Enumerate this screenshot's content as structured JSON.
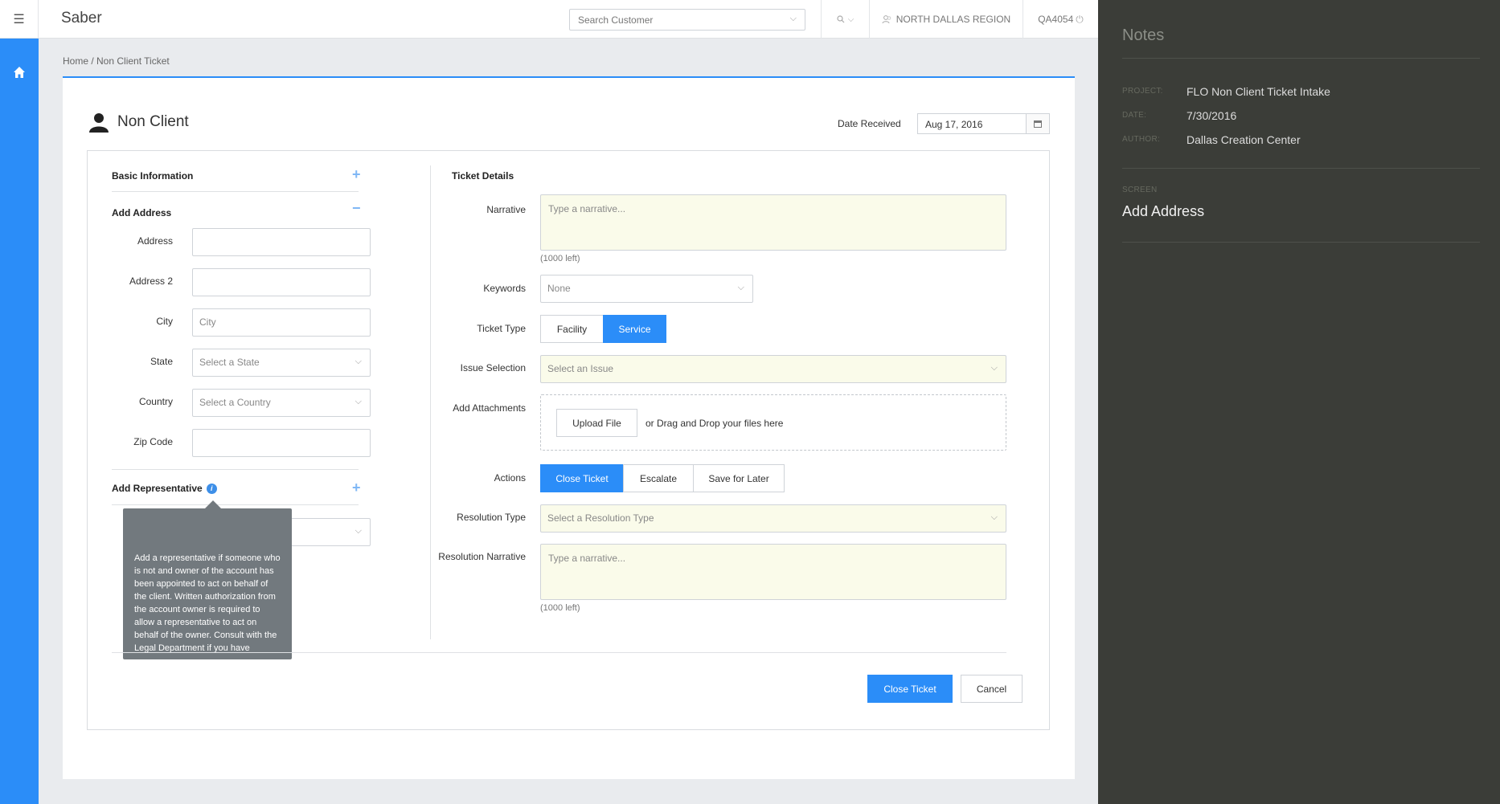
{
  "header": {
    "brand": "Saber",
    "search_placeholder": "Search Customer",
    "region": "NORTH DALLAS REGION",
    "user": "QA4054"
  },
  "breadcrumb": "Home / Non Client Ticket",
  "page": {
    "title": "Non Client",
    "date_label": "Date Received",
    "date_value": "Aug 17, 2016"
  },
  "basic_info": {
    "title": "Basic Information",
    "add_address_title": "Add Address",
    "fields": [
      {
        "label": "Address",
        "value": "",
        "placeholder": ""
      },
      {
        "label": "Address 2",
        "value": "",
        "placeholder": ""
      },
      {
        "label": "City",
        "value": "",
        "placeholder": "City"
      },
      {
        "label": "State",
        "value": "Select a State"
      },
      {
        "label": "Country",
        "value": "Select a Country"
      },
      {
        "label": "Zip Code",
        "value": "",
        "placeholder": ""
      }
    ],
    "add_rep_title": "Add Representative",
    "tooltip": "Add a representative if someone who is not and owner of the account has been appointed to act on behalf of the client. Written authorization from the account owner is required to allow a representative to act on behalf of the owner. Consult with the Legal Department if you have"
  },
  "ticket": {
    "title": "Ticket Details",
    "narrative_label": "Narrative",
    "narrative_placeholder": "Type a narrative...",
    "narrative_left": "(1000 left)",
    "keywords_label": "Keywords",
    "keywords_value": "None",
    "ticket_type_label": "Ticket Type",
    "ticket_type_options": [
      "Facility",
      "Service"
    ],
    "ticket_type_selected": "Service",
    "issue_label": "Issue Selection",
    "issue_value": "Select an Issue",
    "attachments_label": "Add Attachments",
    "upload_label": "Upload File",
    "drop_text": "or Drag and Drop your files here",
    "actions_label": "Actions",
    "actions": [
      "Close Ticket",
      "Escalate",
      "Save for Later"
    ],
    "actions_selected": "Close Ticket",
    "resolution_type_label": "Resolution Type",
    "resolution_type_value": "Select a Resolution Type",
    "resolution_narrative_label": "Resolution Narrative",
    "resolution_narrative_placeholder": "Type a narrative...",
    "resolution_left": "(1000 left)"
  },
  "footer": {
    "submit": "Close Ticket",
    "cancel": "Cancel"
  },
  "notes": {
    "title": "Notes",
    "project_key": "PROJECT:",
    "project_value": "FLO Non Client Ticket Intake",
    "date_key": "DATE:",
    "date_value": "7/30/2016",
    "author_key": "AUTHOR:",
    "author_value": "Dallas Creation Center",
    "screen_key": "SCREEN",
    "screen_value": "Add Address"
  },
  "colors": {
    "accent": "#2b8df8",
    "notes_bg": "#3b3d38",
    "input_highlight": "#fafbea"
  }
}
